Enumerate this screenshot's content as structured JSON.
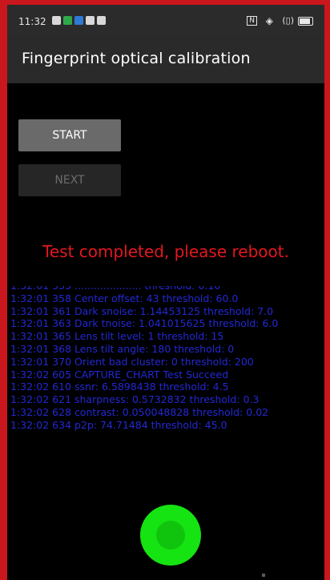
{
  "status_bar": {
    "time": "11:32",
    "notification_icons": [
      "message-icon",
      "app-icon-green",
      "app-icon-blue",
      "app-icon",
      "app-icon"
    ],
    "right_icons": [
      "nfc-icon",
      "wifi-icon",
      "vibrate-icon",
      "battery-icon"
    ],
    "nfc_glyph": "N",
    "wifi_glyph": "◈",
    "vibrate_glyph": "(▯)"
  },
  "app_bar": {
    "title": "Fingerprint optical calibration"
  },
  "controls": {
    "start_label": "START",
    "next_label": "NEXT"
  },
  "result": {
    "message": "Test completed, please reboot."
  },
  "log": {
    "lines": [
      "1:32:01 358 Center offset: 43 threshold: 60.0",
      "1:32:01 361 Dark snoise: 1.14453125 threshold: 7.0",
      "1:32:01 363 Dark tnoise: 1.041015625 threshold: 6.0",
      "1:32:01 365 Lens tilt level: 1 threshold: 15",
      "1:32:01 368 Lens tilt angle: 180 threshold: 0",
      "1:32:01 370 Orient bad cluster: 0 threshold: 200",
      "1:32:02 605 CAPTURE_CHART Test  Succeed",
      "1:32:02 610 ssnr: 6.5898438 threshold: 4.5",
      "1:32:02 621 sharpness: 0.5732832 threshold: 0.3",
      "1:32:02 628 contrast: 0.050048828 threshold: 0.02",
      "1:32:02 634 p2p: 74.71484 threshold: 45.0"
    ]
  },
  "colors": {
    "frame": "#c9171d",
    "message": "#e3181e",
    "log_text": "#2328d4",
    "fingerprint": "#16e312"
  }
}
